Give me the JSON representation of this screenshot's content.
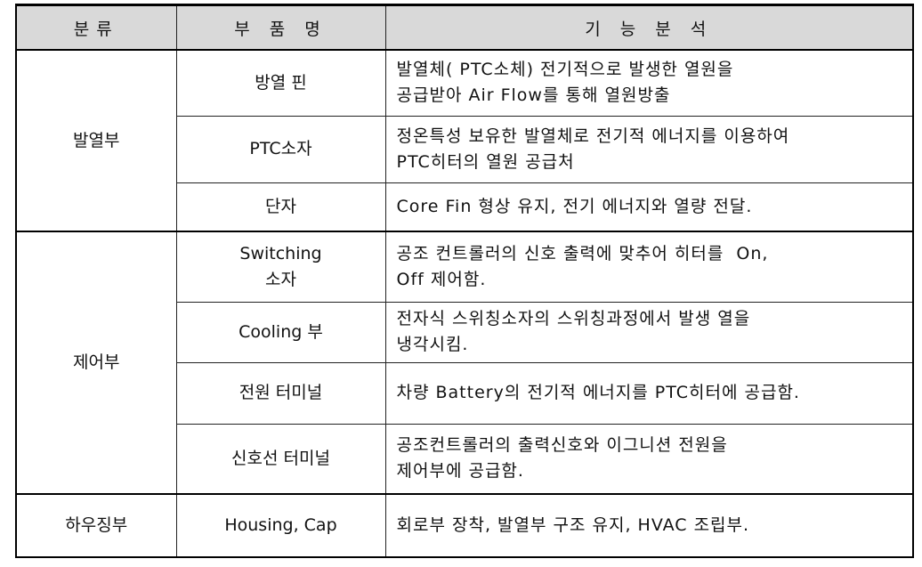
{
  "header": {
    "category": "분류",
    "part": "부 품 명",
    "function": "기 능 분 석"
  },
  "groups": [
    {
      "category": "발열부",
      "rows": [
        {
          "part": [
            "방열 핀"
          ],
          "function": [
            "발열체( PTC소체) 전기적으로 발생한 열원을",
            "공급받아 Air Flow를 통해 열원방출"
          ]
        },
        {
          "part": [
            "PTC소자"
          ],
          "function": [
            "정온특성 보유한 발열체로 전기적 에너지를 이용하여",
            "PTC히터의 열원 공급처"
          ]
        },
        {
          "part": [
            "단자"
          ],
          "function": [
            "Core Fin 형상 유지, 전기 에너지와 열량 전달."
          ]
        }
      ]
    },
    {
      "category": "제어부",
      "rows": [
        {
          "part": [
            "Switching",
            "소자"
          ],
          "function": [
            "공조 컨트롤러의 신호 출력에 맞추어 히터를  On,",
            "Off 제어함."
          ]
        },
        {
          "part": [
            "Cooling 부"
          ],
          "function": [
            "전자식 스위칭소자의 스위칭과정에서 발생 열을",
            "냉각시킴."
          ]
        },
        {
          "part": [
            "전원 터미널"
          ],
          "function": [
            "차량 Battery의 전기적 에너지를 PTC히터에 공급함."
          ]
        },
        {
          "part": [
            "신호선 터미널"
          ],
          "function": [
            "공조컨트롤러의 출력신호와 이그니션 전원을",
            "제어부에 공급함."
          ]
        }
      ]
    },
    {
      "category": "하우징부",
      "rows": [
        {
          "part": [
            "Housing, Cap"
          ],
          "function": [
            "회로부 장착, 발열부 구조 유지, HVAC 조립부."
          ]
        }
      ]
    }
  ]
}
